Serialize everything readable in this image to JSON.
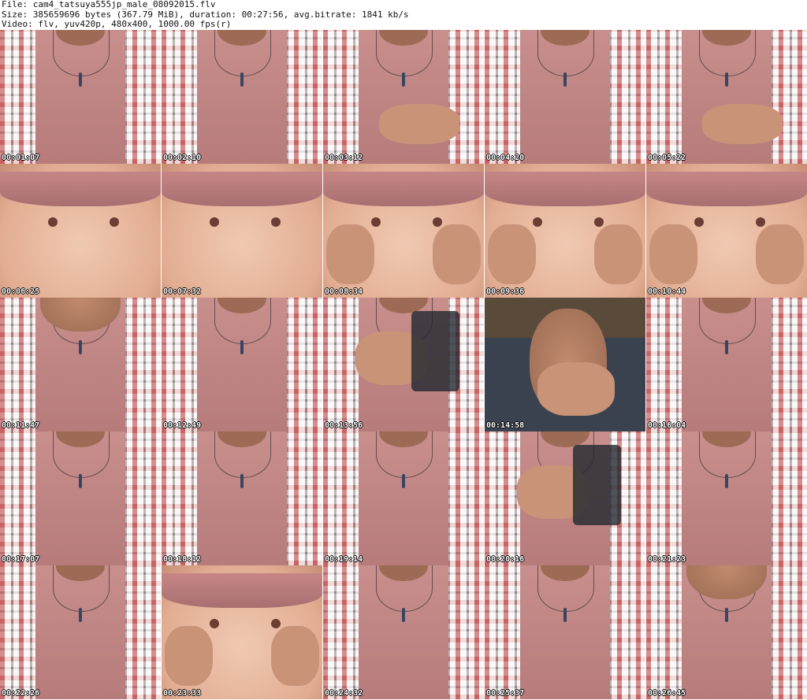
{
  "header": {
    "line1": "File: cam4_tatsuya555jp_male_08092015.flv",
    "line2": "Size: 385659696 bytes (367.79 MiB), duration: 00:27:56, avg.bitrate: 1841 kb/s",
    "line3": "Video: flv, yuv420p, 480x400, 1000.00 fps(r)"
  },
  "thumbnails": [
    {
      "time": "00:01:07",
      "scene": "shirt"
    },
    {
      "time": "00:02:10",
      "scene": "shirt"
    },
    {
      "time": "00:03:12",
      "scene": "shirt-hand"
    },
    {
      "time": "00:04:20",
      "scene": "shirt"
    },
    {
      "time": "00:05:22",
      "scene": "shirt-hand"
    },
    {
      "time": "00:06:25",
      "scene": "chest"
    },
    {
      "time": "00:07:32",
      "scene": "chest"
    },
    {
      "time": "00:08:34",
      "scene": "chest-hands"
    },
    {
      "time": "00:09:36",
      "scene": "chest-hands"
    },
    {
      "time": "00:10:44",
      "scene": "chest-hands"
    },
    {
      "time": "00:11:47",
      "scene": "shirt-chin"
    },
    {
      "time": "00:12:49",
      "scene": "shirt"
    },
    {
      "time": "00:13:56",
      "scene": "shirt-object"
    },
    {
      "time": "00:14:58",
      "scene": "face"
    },
    {
      "time": "00:16:04",
      "scene": "shirt"
    },
    {
      "time": "00:17:07",
      "scene": "shirt"
    },
    {
      "time": "00:18:12",
      "scene": "shirt"
    },
    {
      "time": "00:19:14",
      "scene": "shirt"
    },
    {
      "time": "00:20:16",
      "scene": "shirt-object"
    },
    {
      "time": "00:21:23",
      "scene": "shirt"
    },
    {
      "time": "00:22:26",
      "scene": "shirt"
    },
    {
      "time": "00:23:33",
      "scene": "chest-hands"
    },
    {
      "time": "00:24:32",
      "scene": "shirt"
    },
    {
      "time": "00:25:37",
      "scene": "shirt"
    },
    {
      "time": "00:26:45",
      "scene": "shirt-chin"
    }
  ]
}
